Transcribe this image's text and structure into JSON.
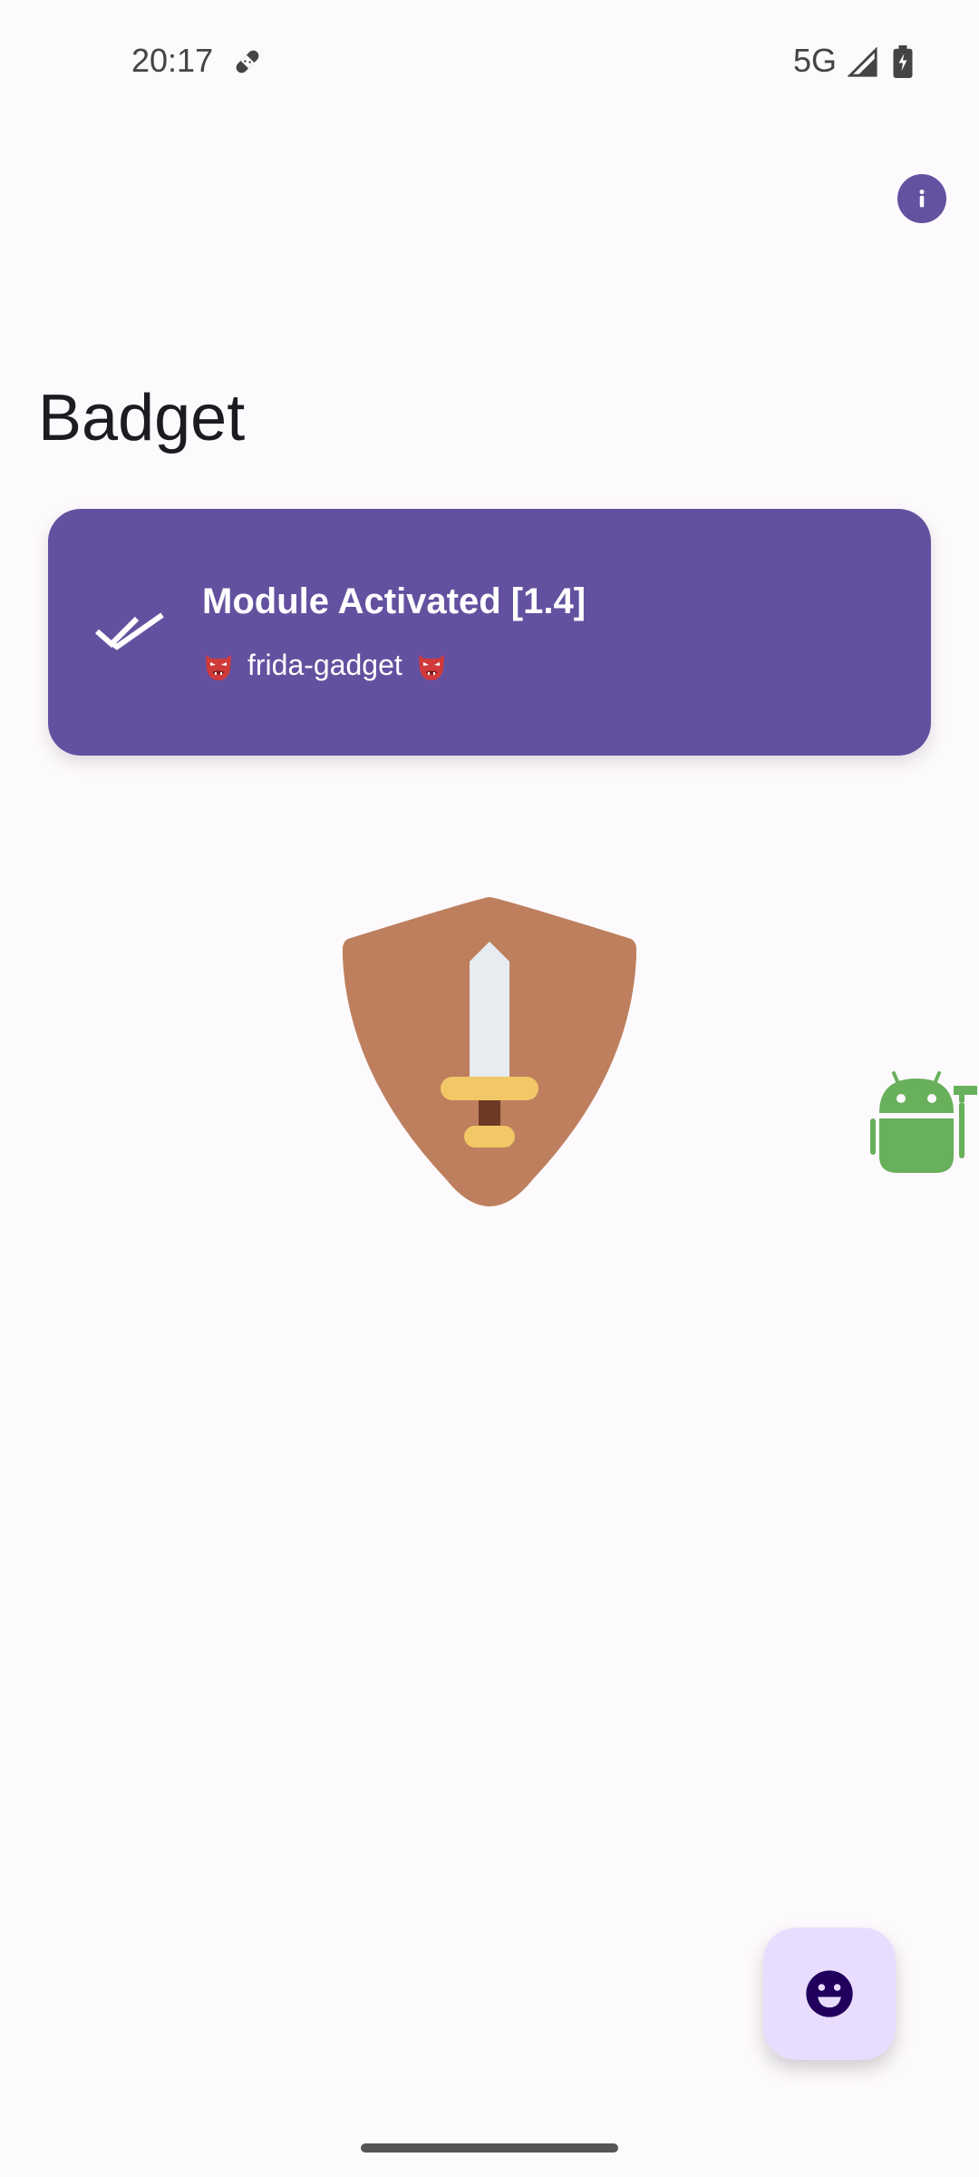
{
  "status_bar": {
    "time": "20:17",
    "network": "5G",
    "icons": [
      "bandage-icon",
      "signal-icon",
      "battery-charging-icon"
    ]
  },
  "header": {
    "info_icon": "info-icon"
  },
  "page": {
    "title": "Badget"
  },
  "status_card": {
    "title": "Module Activated [1.4]",
    "subtitle": "frida-gadget",
    "icon": "double-check-icon",
    "decor_icon": "goblin-mask-icon"
  },
  "illustrations": {
    "shield": "shield-sword-icon",
    "android": "android-builder-icon"
  },
  "fab": {
    "icon": "smiley-icon"
  },
  "colors": {
    "accent": "#6351a0",
    "fab_bg": "#e9ddff",
    "background": "#fdfafd"
  }
}
